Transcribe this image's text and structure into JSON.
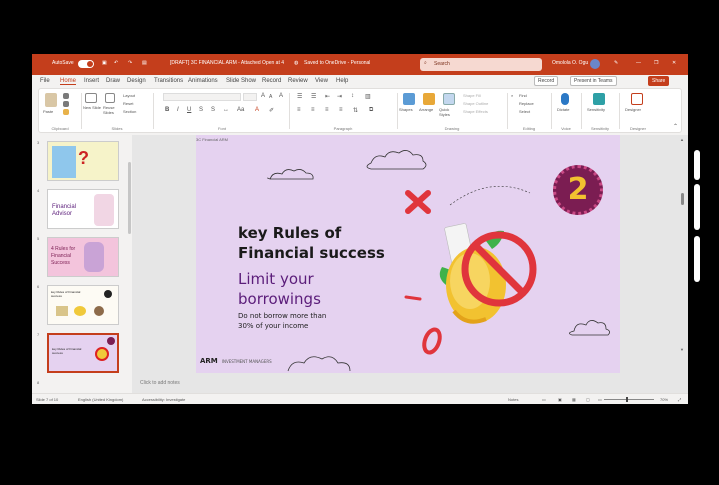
{
  "window": {
    "autosave_label": "AutoSave",
    "file_title": "[DRAFT] 3C FINANCIAL ARM - Attached Open at 4",
    "saved_status": "Saved to OneDrive - Personal",
    "search_placeholder": "Search",
    "user_name": "Omolola O. Ogunbayo"
  },
  "tabs": [
    "File",
    "Home",
    "Insert",
    "Draw",
    "Design",
    "Transitions",
    "Animations",
    "Slide Show",
    "Record",
    "Review",
    "View",
    "Help"
  ],
  "top_buttons": {
    "record": "Record",
    "present": "Present in Teams",
    "share": "Share"
  },
  "ribbon": {
    "groups": {
      "clipboard": "Clipboard",
      "slides": "Slides",
      "font": "Font",
      "paragraph": "Paragraph",
      "drawing": "Drawing",
      "editing": "Editing",
      "voice": "Voice",
      "sensitivity": "Sensitivity",
      "designer": "Designer"
    },
    "buttons": {
      "paste": "Paste",
      "new_slide": "New Slide",
      "reuse_slides": "Reuse Slides",
      "layout": "Layout",
      "reset": "Reset",
      "section": "Section",
      "shapes": "Shapes",
      "arrange": "Arrange",
      "quick_styles": "Quick Styles",
      "shape_fill": "Shape Fill",
      "shape_outline": "Shape Outline",
      "shape_effects": "Shape Effects",
      "find": "Find",
      "replace": "Replace",
      "select": "Select",
      "dictate": "Dictate",
      "sensitivity_btn": "Sensitivity",
      "designer_btn": "Designer"
    }
  },
  "thumbnails": [
    {
      "num": "3",
      "title": ""
    },
    {
      "num": "4",
      "title": "Financial Advisor"
    },
    {
      "num": "5",
      "title": "4 Rules for Financial Success"
    },
    {
      "num": "6",
      "title": "key Rules of Financial success"
    },
    {
      "num": "7",
      "title": "key Rules of Financial success"
    }
  ],
  "slide": {
    "top_label": "3C Financial ARM",
    "title_line1": "key Rules of",
    "title_line2": "Financial success",
    "subtitle_line1": "Limit your",
    "subtitle_line2": "borrowings",
    "body_line1": "Do not borrow more than",
    "body_line2": "30% of your income",
    "badge_number": "2",
    "logo_text": "ARM",
    "logo_sub": "INVESTMENT MANAGERS"
  },
  "notes_placeholder": "Click to add notes",
  "status": {
    "slide_info": "Slide 7 of 10",
    "language": "English (United Kingdom)",
    "accessibility": "Accessibility: Investigate",
    "notes": "Notes",
    "zoom": "70%"
  },
  "colors": {
    "accent": "#c43e1c",
    "slide_bg": "#e5d2f0",
    "subtitle": "#5b1d7a",
    "badge": "#7b1d52",
    "badge_text": "#f2c230"
  }
}
